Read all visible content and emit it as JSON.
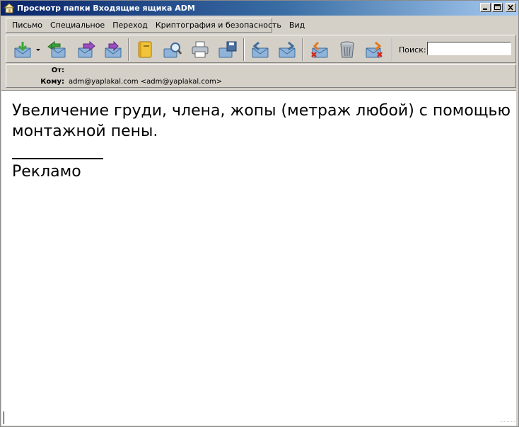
{
  "window": {
    "title": "Просмотр папки Входящие ящика ADM"
  },
  "menu": [
    {
      "label": "Письмо"
    },
    {
      "label": "Специальное"
    },
    {
      "label": "Переход"
    },
    {
      "label": "Криптография и безопасность"
    },
    {
      "label": "Вид"
    }
  ],
  "toolbar": {
    "icons": [
      "get-mail-icon",
      "dropdown-arrow-icon",
      "reply-all-icon",
      "forward-icon",
      "redirect-icon",
      "address-book-icon",
      "find-message-icon",
      "print-icon",
      "save-icon",
      "previous-message-icon",
      "next-message-icon",
      "delete-message-icon",
      "trash-icon",
      "mark-spam-icon"
    ],
    "search_label": "Поиск:",
    "search_value": ""
  },
  "headers": {
    "from_label": "От:",
    "from_value": "",
    "to_label": "Кому:",
    "to_value": "adm@yaplakal.com <adm@yaplakal.com>"
  },
  "message": {
    "line1": "Увеличение груди, члена, жопы (метраж любой) с помощью",
    "line2": "монтажной пены.",
    "signature": "Рекламо"
  },
  "colors": {
    "title_start": "#0a246a",
    "title_end": "#a6caf0",
    "chrome": "#d4d0c8",
    "envelope_blue": "#8fb3d9",
    "arrow_green": "#3aa53a",
    "arrow_purple": "#9b4fc2",
    "arrow_orange": "#e07a1f"
  }
}
